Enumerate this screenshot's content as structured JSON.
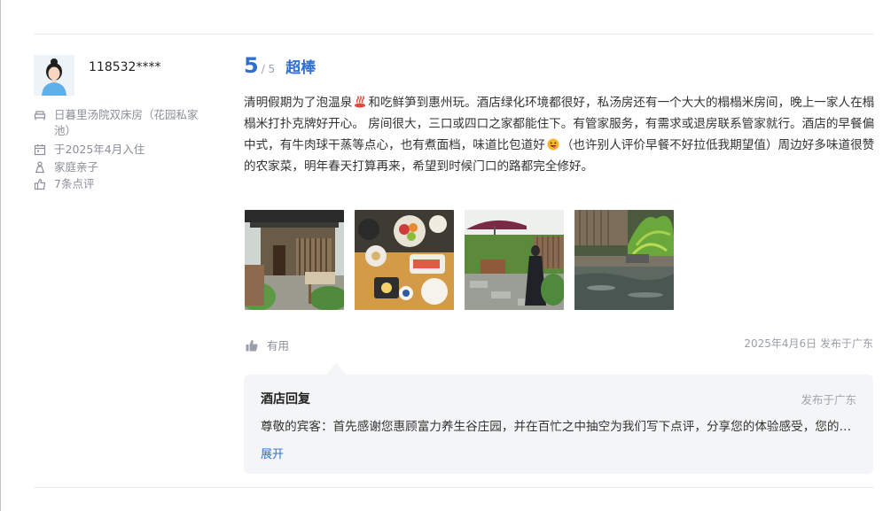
{
  "user": {
    "name": "118532****",
    "room_type": "日暮里汤院双床房（花园私家池）",
    "stay_date": "于2025年4月入住",
    "trip_type": "家庭亲子",
    "review_count": "7条点评"
  },
  "review": {
    "score": "5",
    "score_max": "/ 5",
    "grade": "超棒",
    "text_part1": "清明假期为了泡温泉",
    "text_part2": "和吃鲜笋到惠州玩。酒店绿化环境都很好，私汤房还有一个大大的榻榻米房间，晚上一家人在榻榻米打扑克牌好开心。 房间很大，三口或四口之家都能住下。有管家服务，有需求或退房联系管家就行。酒店的早餐偏中式，有牛肉球干蒸等点心，也有煮面档，味道比包道好",
    "text_part3": "（也许别人评价早餐不好拉低我期望值）周边好多味道很赞的农家菜，明年春天打算再来，希望到时候门口的路都完全修好。",
    "helpful_label": "有用",
    "posted": "2025年4月6日 发布于广东"
  },
  "hotel_reply": {
    "title": "酒店回复",
    "location": "发布于广东",
    "text": "尊敬的宾客：首先感谢您惠顾富力养生谷庄园，并在百忙之中抽空为我们写下点评，分享您的体验感受，您的满意是我们最大的动力。",
    "expand_label": "展开"
  },
  "colors": {
    "accent": "#2f6fd1",
    "muted": "#8a8f99",
    "reply_bg": "#f4f5f7"
  }
}
